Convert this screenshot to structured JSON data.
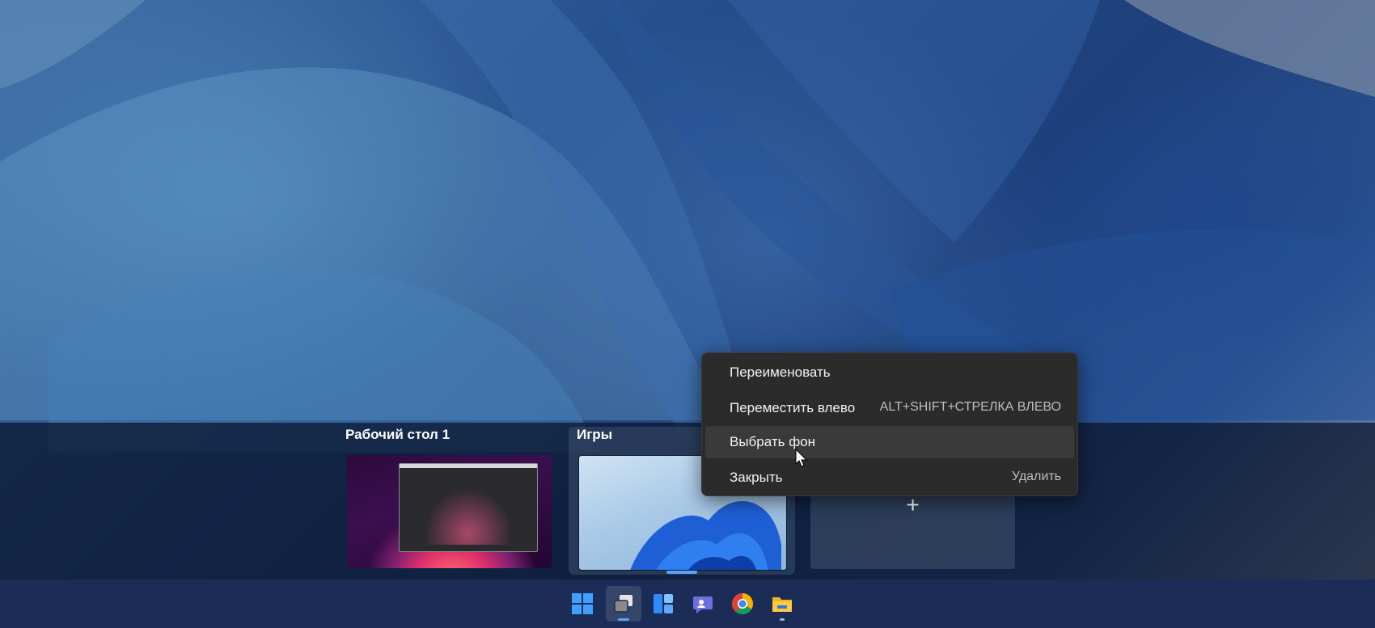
{
  "desktops": [
    {
      "title": "Рабочий стол 1"
    },
    {
      "title": "Игры"
    }
  ],
  "new_desktop": {
    "icon": "plus-icon",
    "label": "+"
  },
  "context_menu": {
    "items": [
      {
        "label": "Переименовать",
        "shortcut": ""
      },
      {
        "label": "Переместить влево",
        "shortcut": "ALT+SHIFT+СТРЕЛКА ВЛЕВО"
      },
      {
        "label": "Выбрать фон",
        "shortcut": ""
      },
      {
        "label": "Закрыть",
        "shortcut": "Удалить"
      }
    ],
    "hovered_item": "Выбрать фон"
  },
  "taskbar": {
    "icons": [
      {
        "name": "start-icon"
      },
      {
        "name": "task-view-icon",
        "active": true
      },
      {
        "name": "widgets-icon"
      },
      {
        "name": "teams-chat-icon"
      },
      {
        "name": "chrome-icon"
      },
      {
        "name": "file-explorer-icon"
      }
    ]
  },
  "colors": {
    "accent": "#5aa2ff",
    "menu_bg": "#2b2b2b",
    "taskbar_bg": "#1b2d56"
  }
}
